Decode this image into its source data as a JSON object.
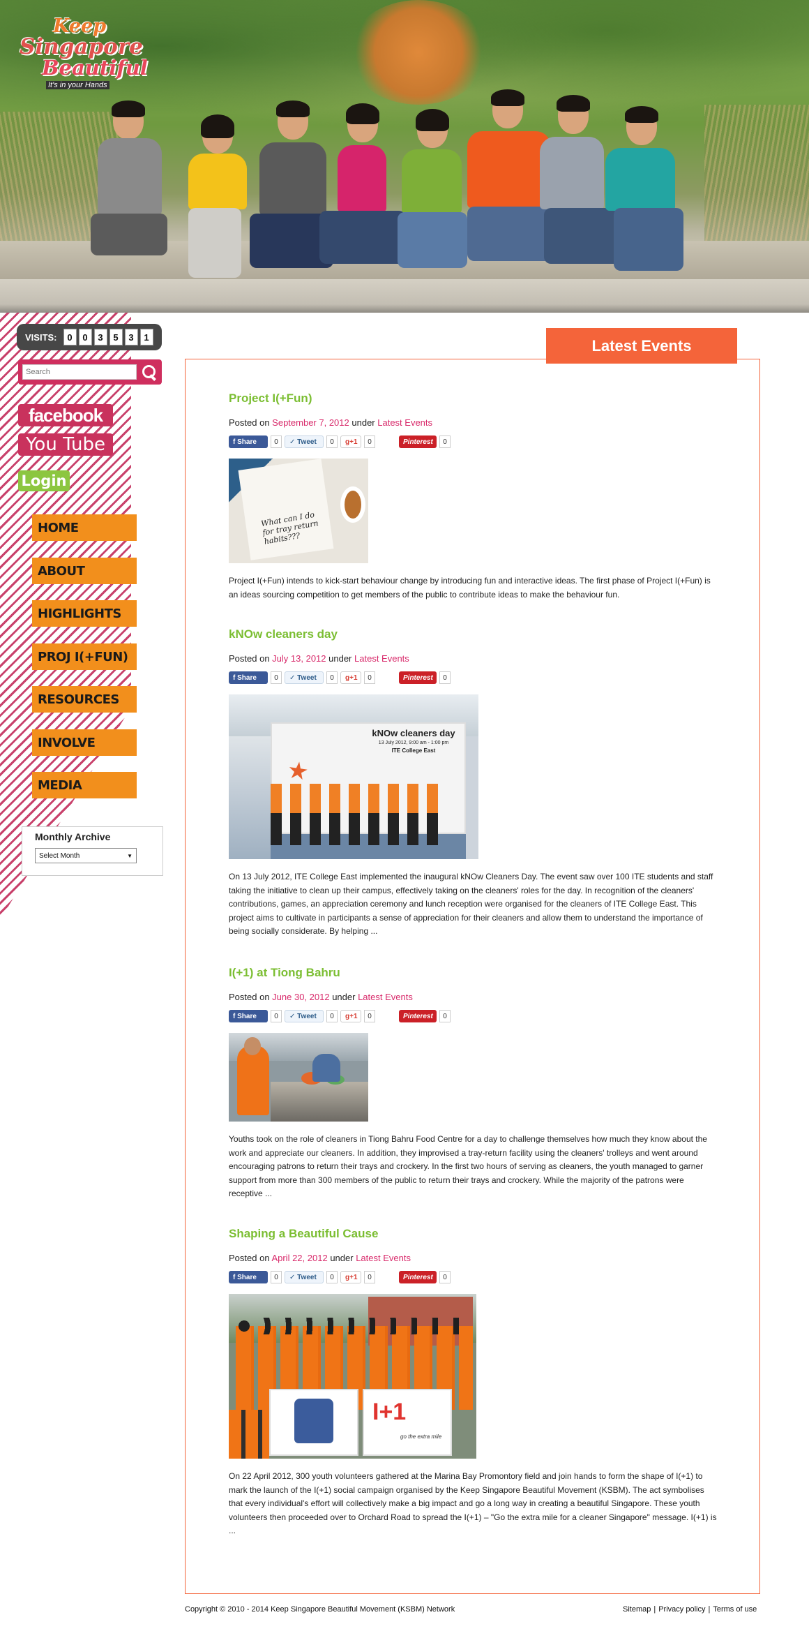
{
  "logo": {
    "line1": "Keep",
    "line2": "Singapore",
    "line3": "Beautiful",
    "tagline": "It's in your Hands"
  },
  "visits": {
    "label": "VISITS:",
    "digits": [
      "0",
      "0",
      "3",
      "5",
      "3",
      "1"
    ]
  },
  "search": {
    "placeholder": "Search"
  },
  "social": {
    "facebook": "facebook",
    "youtube": "You Tube",
    "login": "Login"
  },
  "nav": {
    "items": [
      {
        "label": "HOME"
      },
      {
        "label": "ABOUT"
      },
      {
        "label": "HIGHLIGHTS"
      },
      {
        "label": "PROJ I(+FUN)"
      },
      {
        "label": "RESOURCES"
      },
      {
        "label": "INVOLVE"
      },
      {
        "label": "MEDIA"
      }
    ]
  },
  "archive": {
    "title": "Monthly Archive",
    "select_value": "Select Month"
  },
  "section_title": "Latest Events",
  "share": {
    "share_label": "Share",
    "tweet_label": "Tweet",
    "gplus_label": "g+1",
    "pinterest_label": "Pinterest",
    "count": "0"
  },
  "posts": [
    {
      "title": "Project I(+Fun)",
      "posted_on": "Posted on",
      "date": "September 7, 2012",
      "under": "under",
      "category": "Latest Events",
      "excerpt": "Project I(+Fun) intends to kick-start behaviour change by introducing fun and interactive ideas. The first phase of Project I(+Fun) is an ideas sourcing competition to get members of the public to contribute ideas to make the behaviour fun."
    },
    {
      "title": "kNOw cleaners day",
      "posted_on": "Posted on",
      "date": "July 13, 2012",
      "under": "under",
      "category": "Latest Events",
      "image_heading": "kNOw cleaners day",
      "image_sub": "13 July 2012, 9:00 am - 1:00 pm",
      "image_venue": "ITE College East",
      "excerpt": "On 13 July 2012, ITE College East implemented the inaugural kNOw Cleaners Day. The event saw over 100 ITE students and staff taking the initiative to clean up their campus, effectively taking on the cleaners' roles for the day. In recognition of the cleaners' contributions, games, an appreciation ceremony and lunch reception were organised for the cleaners of ITE College East. This project aims to cultivate in participants a sense of appreciation for their cleaners and allow them to understand the importance of being socially considerate. By helping ..."
    },
    {
      "title": "I(+1) at Tiong Bahru",
      "posted_on": "Posted on",
      "date": "June 30, 2012",
      "under": "under",
      "category": "Latest Events",
      "excerpt": "Youths took on the role of cleaners in Tiong Bahru Food Centre for a day to challenge themselves how much they know about the work and appreciate our cleaners. In addition, they improvised a tray-return facility using the cleaners' trolleys and went around encouraging patrons to return their trays and crockery. In the first two hours of serving as cleaners, the youth managed to garner support from more than 300 members of the public to return their trays and crockery. While the majority of the patrons were receptive ..."
    },
    {
      "title": "Shaping a Beautiful Cause",
      "posted_on": "Posted on",
      "date": "April 22, 2012",
      "under": "under",
      "category": "Latest Events",
      "image_sign": "I+1",
      "image_tag": "go the extra mile",
      "excerpt": "On 22 April 2012, 300 youth volunteers gathered at the Marina Bay Promontory field and join hands to form the shape of I(+1) to mark the launch of the I(+1) social campaign organised by the Keep Singapore Beautiful Movement (KSBM). The act symbolises that every individual's effort will collectively make a big impact and go a long way in creating a beautiful Singapore. These youth volunteers then proceeded over to Orchard Road to spread the I(+1) – \"Go the extra mile for a cleaner Singapore\" message. I(+1) is ..."
    }
  ],
  "thumb1": {
    "note1": "What can I do",
    "note2": "for tray return",
    "note3": "habits???"
  },
  "footer": {
    "copyright": "Copyright © 2010 - 2014 Keep Singapore Beautiful Movement (KSBM) Network",
    "links": [
      "Sitemap",
      "Privacy policy",
      "Terms of use"
    ],
    "separator": "|"
  },
  "colors": {
    "accent_orange": "#f4643a",
    "nav_orange": "#f28f1c",
    "title_green": "#7bbe32",
    "link_pink": "#d8296a",
    "stripe_pink": "#c8416b"
  }
}
